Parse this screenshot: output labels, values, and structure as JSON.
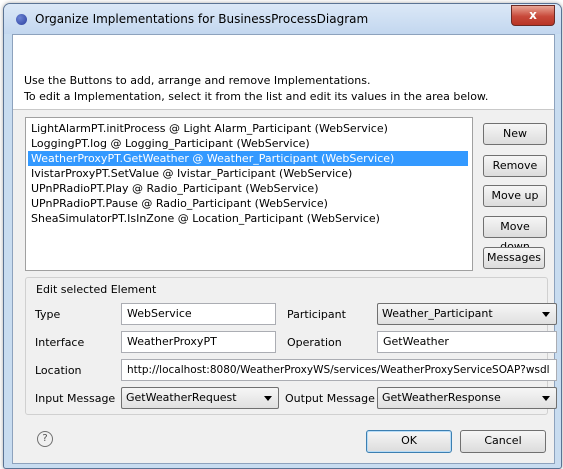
{
  "window": {
    "title": "Organize Implementations for BusinessProcessDiagram",
    "close_label": "x"
  },
  "banner": {
    "line1": "Use the Buttons to add, arrange and remove Implementations.",
    "line2": "To edit a Implementation, select it from the list and edit its values in the area below."
  },
  "implementations": [
    {
      "label": "LightAlarmPT.initProcess @ Light Alarm_Participant (WebService)",
      "selected": false
    },
    {
      "label": "LoggingPT.log @ Logging_Participant (WebService)",
      "selected": false
    },
    {
      "label": "WeatherProxyPT.GetWeather @ Weather_Participant (WebService)",
      "selected": true
    },
    {
      "label": "IvistarProxyPT.SetValue @ Ivistar_Participant (WebService)",
      "selected": false
    },
    {
      "label": "UPnPRadioPT.Play @ Radio_Participant (WebService)",
      "selected": false
    },
    {
      "label": "UPnPRadioPT.Pause @ Radio_Participant (WebService)",
      "selected": false
    },
    {
      "label": "SheaSimulatorPT.IsInZone @ Location_Participant (WebService)",
      "selected": false
    }
  ],
  "side_buttons": {
    "new": "New",
    "remove": "Remove",
    "move_up": "Move up",
    "move_down": "Move down",
    "messages": "Messages"
  },
  "edit": {
    "group_title": "Edit selected Element",
    "type_label": "Type",
    "type_value": "WebService",
    "participant_label": "Participant",
    "participant_value": "Weather_Participant",
    "interface_label": "Interface",
    "interface_value": "WeatherProxyPT",
    "operation_label": "Operation",
    "operation_value": "GetWeather",
    "location_label": "Location",
    "location_value": "http://localhost:8080/WeatherProxyWS/services/WeatherProxyServiceSOAP?wsdl",
    "input_label": "Input Message",
    "input_value": "GetWeatherRequest",
    "output_label": "Output Message",
    "output_value": "GetWeatherResponse"
  },
  "footer": {
    "help_glyph": "?",
    "ok": "OK",
    "cancel": "Cancel"
  },
  "colors": {
    "selection": "#3399ff",
    "titlebar": "#c3d7ef",
    "close": "#c8493a"
  }
}
